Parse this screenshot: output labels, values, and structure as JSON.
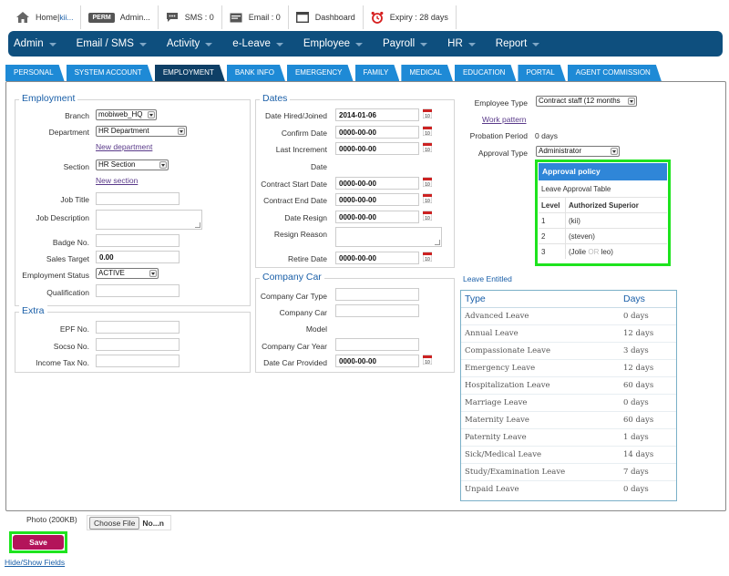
{
  "topbar": {
    "home_label": "Home",
    "home_sep": " | ",
    "home_user": "kii...",
    "perm_badge": "PERM",
    "admin_label": "Admin...",
    "sms_label": "SMS : 0",
    "email_label": "Email : 0",
    "dashboard_label": "Dashboard",
    "expiry_label": "Expiry : 28 days"
  },
  "mainnav": [
    "Admin",
    "Email / SMS",
    "Activity",
    "e-Leave",
    "Employee",
    "Payroll",
    "HR",
    "Report"
  ],
  "tabs": [
    "PERSONAL",
    "SYSTEM ACCOUNT",
    "EMPLOYMENT",
    "BANK INFO",
    "EMERGENCY",
    "FAMILY",
    "MEDICAL",
    "EDUCATION",
    "PORTAL",
    "AGENT COMMISSION"
  ],
  "active_tab": "EMPLOYMENT",
  "employment": {
    "legend": "Employment",
    "branch_label": "Branch",
    "branch_value": "mobiweb_HQ",
    "department_label": "Department",
    "department_value": "HR Department",
    "new_department_link": "New department",
    "section_label": "Section",
    "section_value": "HR Section",
    "new_section_link": "New section",
    "job_title_label": "Job Title",
    "job_description_label": "Job Description",
    "badge_no_label": "Badge No.",
    "sales_target_label": "Sales Target",
    "sales_target_value": "0.00",
    "employment_status_label": "Employment Status",
    "employment_status_value": "ACTIVE",
    "qualification_label": "Qualification"
  },
  "extra": {
    "legend": "Extra",
    "epf_label": "EPF No.",
    "socso_label": "Socso No.",
    "income_tax_label": "Income Tax No."
  },
  "dates": {
    "legend": "Dates",
    "date_hired_label": "Date Hired/Joined",
    "date_hired_value": "2014-01-06",
    "confirm_date_label": "Confirm Date",
    "confirm_date_value": "0000-00-00",
    "last_increment_label": "Last Increment",
    "last_increment_label2": "Date",
    "last_increment_value": "0000-00-00",
    "contract_start_label": "Contract Start Date",
    "contract_start_value": "0000-00-00",
    "contract_end_label": "Contract End Date",
    "contract_end_value": "0000-00-00",
    "date_resign_label": "Date Resign",
    "date_resign_value": "0000-00-00",
    "resign_reason_label": "Resign Reason",
    "retire_date_label": "Retire Date",
    "retire_date_value": "0000-00-00"
  },
  "company_car": {
    "legend": "Company Car",
    "type_label": "Company Car Type",
    "model_label": "Company Car",
    "model_label2": "Model",
    "year_label": "Company Car Year",
    "date_provided_label": "Date Car Provided",
    "date_provided_value": "0000-00-00"
  },
  "right": {
    "employee_type_label": "Employee Type",
    "employee_type_value": "Contract staff (12 months",
    "work_pattern_link": "Work pattern",
    "probation_label": "Probation Period",
    "probation_value": "0 days",
    "approval_type_label": "Approval Type",
    "approval_type_value": "Administrator"
  },
  "approval_policy": {
    "title": "Approval policy",
    "subtitle": "Leave Approval Table",
    "col_level": "Level",
    "col_superior": "Authorized Superior",
    "rows": [
      {
        "level": "1",
        "superior": "(kii)"
      },
      {
        "level": "2",
        "superior": "(steven)"
      },
      {
        "level": "3",
        "superior_a": "(Jolie ",
        "superior_or": "OR",
        "superior_b": " leo)"
      }
    ]
  },
  "leave_entitled": {
    "title": "Leave Entitled",
    "col_type": "Type",
    "col_days": "Days",
    "rows": [
      {
        "type": "Advanced Leave",
        "days": "0 days"
      },
      {
        "type": "Annual Leave",
        "days": "12 days"
      },
      {
        "type": "Compassionate Leave",
        "days": "3 days"
      },
      {
        "type": "Emergency Leave",
        "days": "12 days"
      },
      {
        "type": "Hospitalization Leave",
        "days": "60 days"
      },
      {
        "type": "Marriage Leave",
        "days": "0 days"
      },
      {
        "type": "Maternity Leave",
        "days": "60 days"
      },
      {
        "type": "Paternity Leave",
        "days": "1 days"
      },
      {
        "type": "Sick/Medical Leave",
        "days": "14 days"
      },
      {
        "type": "Study/Examination Leave",
        "days": "7 days"
      },
      {
        "type": "Unpaid Leave",
        "days": "0 days"
      }
    ]
  },
  "photo": {
    "label": "Photo (200KB)",
    "choose_file": "Choose File",
    "file_name": "No...n"
  },
  "save_label": "Save",
  "hide_show_link": "Hide/Show Fields",
  "colors": {
    "nav_bg": "#0e4f7e",
    "tab_bg": "#1e8ad6",
    "tab_active": "#0e3f66",
    "highlight": "#1ee31e",
    "save_bg": "#b3145a"
  }
}
